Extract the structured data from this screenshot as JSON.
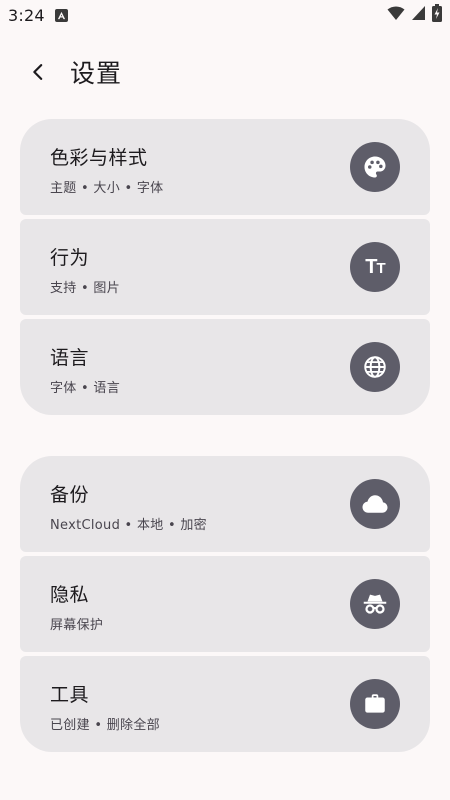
{
  "status_bar": {
    "time": "3:24",
    "notification_icon": "app-notification-icon",
    "icons": [
      "wifi-icon",
      "signal-icon",
      "battery-icon"
    ]
  },
  "header": {
    "title": "设置",
    "back_icon": "back-arrow-icon"
  },
  "groups": [
    {
      "items": [
        {
          "title": "色彩与样式",
          "subtitle": "主题 • 大小 • 字体",
          "icon": "palette-icon"
        },
        {
          "title": "行为",
          "subtitle": "支持 • 图片",
          "icon": "text-size-icon",
          "icon_text": {
            "big": "T",
            "small": "T"
          }
        },
        {
          "title": "语言",
          "subtitle": "字体 • 语言",
          "icon": "globe-icon"
        }
      ]
    },
    {
      "items": [
        {
          "title": "备份",
          "subtitle": "NextCloud • 本地 • 加密",
          "icon": "cloud-icon"
        },
        {
          "title": "隐私",
          "subtitle": "屏幕保护",
          "icon": "incognito-icon"
        },
        {
          "title": "工具",
          "subtitle": "已创建 • 删除全部",
          "icon": "briefcase-icon"
        }
      ]
    }
  ],
  "colors": {
    "background": "#fcf8f8",
    "card": "#e8e6e8",
    "icon_circle": "#5e5d69",
    "text_primary": "#1d1b1e",
    "text_secondary": "#49454e"
  }
}
